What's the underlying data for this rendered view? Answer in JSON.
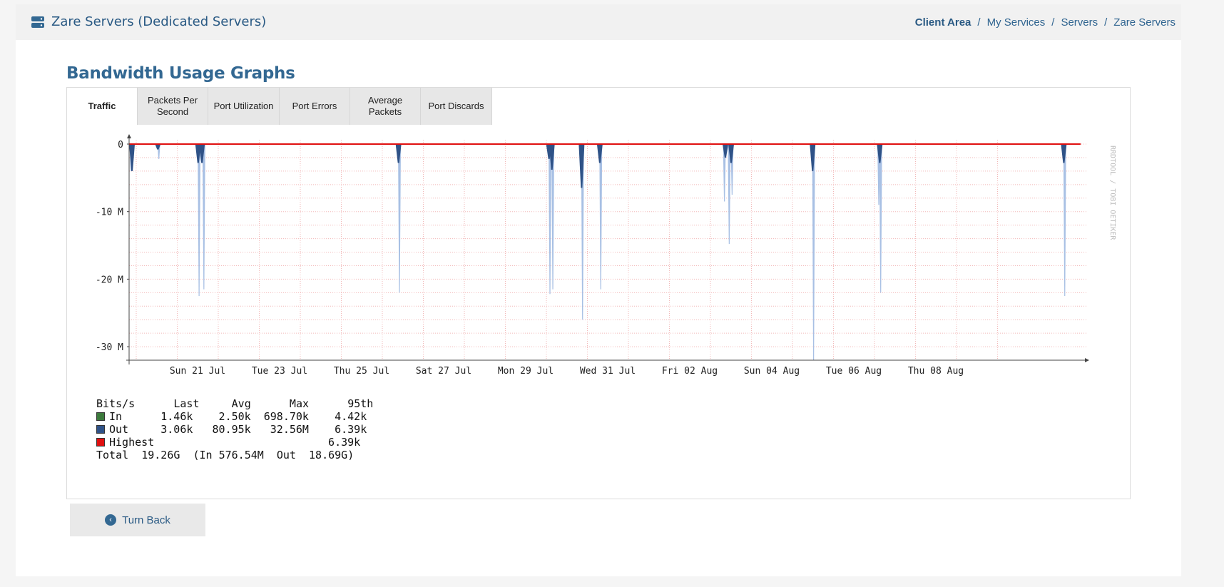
{
  "header": {
    "title": "Zare Servers (Dedicated Servers)",
    "icon": "server-icon",
    "breadcrumb": [
      "Client Area",
      "My Services",
      "Servers",
      "Zare Servers"
    ]
  },
  "section_title": "Bandwidth Usage Graphs",
  "tabs": [
    {
      "label": "Traffic",
      "active": true
    },
    {
      "label": "Packets Per Second",
      "active": false
    },
    {
      "label": "Port Utilization",
      "active": false
    },
    {
      "label": "Port Errors",
      "active": false
    },
    {
      "label": "Average Packets",
      "active": false
    },
    {
      "label": "Port Discards",
      "active": false
    }
  ],
  "chart_data": {
    "type": "area",
    "ylabels": [
      "0",
      "-10 M",
      "-20 M",
      "-30 M"
    ],
    "ylim": [
      -32,
      0
    ],
    "xlabels": [
      "Sun 21 Jul",
      "Tue 23 Jul",
      "Thu 25 Jul",
      "Sat 27 Jul",
      "Mon 29 Jul",
      "Wed 31 Jul",
      "Fri 02 Aug",
      "Sun 04 Aug",
      "Tue 06 Aug",
      "Thu 08 Aug"
    ],
    "watermark": "RRDTOOL / TOBI OETIKER",
    "colors": {
      "in": "#3c7a3c",
      "out": "#2f5287",
      "out_area": "#a8c0e4",
      "highest": "#e01010",
      "grid": "#f2b8b8"
    },
    "spikes_dark": [
      {
        "x": 0.3,
        "depth": 4
      },
      {
        "x": 3.0,
        "depth": 0.8
      },
      {
        "x": 7.2,
        "depth": 2.8
      },
      {
        "x": 7.6,
        "depth": 2.8
      },
      {
        "x": 28.1,
        "depth": 2.8
      },
      {
        "x": 43.8,
        "depth": 2.2
      },
      {
        "x": 44.1,
        "depth": 3.8
      },
      {
        "x": 47.2,
        "depth": 6.5
      },
      {
        "x": 49.1,
        "depth": 2.8
      },
      {
        "x": 62.2,
        "depth": 2.0
      },
      {
        "x": 62.8,
        "depth": 2.8
      },
      {
        "x": 71.3,
        "depth": 4.0
      },
      {
        "x": 78.3,
        "depth": 2.8
      },
      {
        "x": 97.5,
        "depth": 2.8
      }
    ],
    "spikes_light": [
      {
        "x": 0.2,
        "depth": 4
      },
      {
        "x": 3.1,
        "depth": 2.2
      },
      {
        "x": 7.3,
        "depth": 22.5
      },
      {
        "x": 7.8,
        "depth": 21.5
      },
      {
        "x": 28.2,
        "depth": 22
      },
      {
        "x": 43.9,
        "depth": 22.2
      },
      {
        "x": 44.2,
        "depth": 21.5
      },
      {
        "x": 47.3,
        "depth": 26
      },
      {
        "x": 49.2,
        "depth": 21.5
      },
      {
        "x": 62.1,
        "depth": 8.5
      },
      {
        "x": 62.6,
        "depth": 14.8
      },
      {
        "x": 62.9,
        "depth": 7.5
      },
      {
        "x": 71.4,
        "depth": 32
      },
      {
        "x": 78.4,
        "depth": 22
      },
      {
        "x": 78.2,
        "depth": 9
      },
      {
        "x": 97.6,
        "depth": 22.5
      }
    ],
    "legend": {
      "header": "Bits/s      Last     Avg      Max      95th",
      "rows": [
        {
          "name": "In",
          "text": "In      1.46k    2.50k  698.70k    4.42k",
          "color": "#3c7a3c"
        },
        {
          "name": "Out",
          "text": "Out     3.06k   80.95k   32.56M    6.39k",
          "color": "#2f5287"
        },
        {
          "name": "Highest",
          "text": "Highest                           6.39k",
          "color": "#e01010"
        }
      ],
      "total": "Total  19.26G  (In 576.54M  Out  18.69G)"
    }
  },
  "turn_back": "Turn Back"
}
